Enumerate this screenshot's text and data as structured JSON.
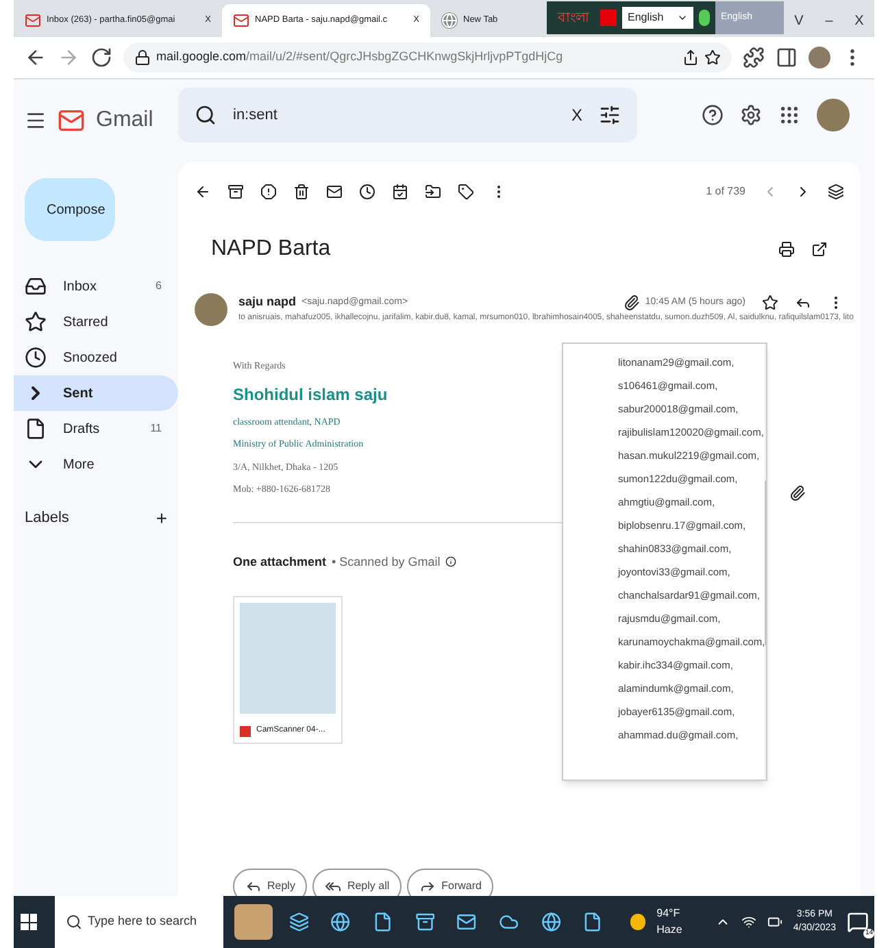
{
  "browser": {
    "tabs": [
      {
        "title": "Inbox (263) - partha.fin05@gmai",
        "selected": false,
        "close": "X"
      },
      {
        "title": "NAPD Barta - saju.napd@gmail.c",
        "selected": true,
        "close": "X"
      },
      {
        "title": "New Tab",
        "selected": false
      }
    ],
    "language_bar": {
      "bangla": "বাংলা",
      "language": "English",
      "ime": "English"
    },
    "window_controls": [
      "V",
      "–",
      "X"
    ],
    "url": {
      "host": "mail.google.com",
      "path": "/mail/u/2/#sent/QgrcJHsbgZGCHKnwgSkjHrljvpPTgdHjCg"
    }
  },
  "gmail": {
    "logo": "Gmail",
    "search": {
      "value": "in:sent",
      "clear": "X"
    },
    "compose": "Compose",
    "nav": [
      {
        "label": "Inbox",
        "count": "6",
        "selected": false
      },
      {
        "label": "Starred",
        "selected": false
      },
      {
        "label": "Snoozed",
        "selected": false
      },
      {
        "label": "Sent",
        "selected": true
      },
      {
        "label": "Drafts",
        "count": "11",
        "selected": false
      },
      {
        "label": "More",
        "selected": false
      }
    ],
    "labels": {
      "title": "Labels",
      "add": "+"
    },
    "pager": "1 of 739",
    "subject": "NAPD Barta",
    "sender": {
      "name": "saju napd",
      "email": "<saju.napd@gmail.com>",
      "time": "10:45 AM (5 hours ago)",
      "to": "to anisruais, mahafuz005, ikhallecojnu, jarifalim, kabir.du8, kamal, mrsumon010, lbrahimhosain4005, shaheenstatdu, sumon.duzh509, Al, saidulknu, rafiquilslam0173, lito"
    },
    "recipients": [
      "litonanam29@gmail.com,",
      "s106461@gmail.com,",
      "sabur200018@gmail.com,",
      "rajibulislam120020@gmail.com,",
      "hasan.mukul2219@gmail.com,",
      "sumon122du@gmail.com,",
      "ahmgtiu@gmail.com,",
      "biplobsenru.17@gmail.com,",
      "shahin0833@gmail.com,",
      "joyontovi33@gmail.com,",
      "chanchalsardar91@gmail.com,",
      "rajusmdu@gmail.com,",
      "karunamoychakma@gmail.com,",
      "kabir.ihc334@gmail.com,",
      "alamindumk@gmail.com,",
      "jobayer6135@gmail.com,",
      "ahammad.du@gmail.com,"
    ],
    "signature": {
      "greeting": "With Regards",
      "name": "Shohidul islam saju",
      "lines": [
        "classroom attendant, NAPD",
        "Ministry of Public Administration",
        "3/A, Nilkhet, Dhaka - 1205",
        "Mob: +880-1626-681728"
      ]
    },
    "attachment": {
      "title": "One attachment",
      "scan": "• Scanned by Gmail",
      "file": "CamScanner 04-..."
    },
    "actions": [
      "Reply",
      "Reply all",
      "Forward"
    ]
  },
  "taskbar": {
    "search": "Type here to search",
    "weather": "94°F  Haze",
    "time": "3:56 PM",
    "date": "4/30/2023",
    "notifications": "14"
  }
}
